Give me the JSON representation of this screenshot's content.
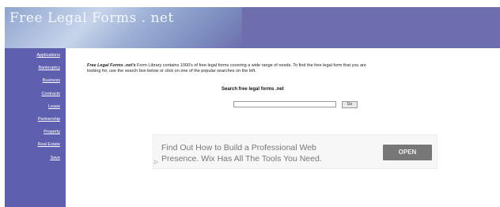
{
  "header": {
    "site_title": "Free Legal Forms . net"
  },
  "sidebar": {
    "items": [
      {
        "label": "Applications"
      },
      {
        "label": "Bankruptcy"
      },
      {
        "label": "Business"
      },
      {
        "label": "Contracts"
      },
      {
        "label": "Lease"
      },
      {
        "label": "Partnership"
      },
      {
        "label": "Property"
      },
      {
        "label": "Real Estate"
      },
      {
        "label": "Save"
      }
    ]
  },
  "main": {
    "intro_brand": "Free Legal Forms .net's",
    "intro_line1": " Form Library contains 1000's of free legal forms covering a wide range of needs. To find the free legal form that you are",
    "intro_line2": "looking for, use the search box below or click on one of the popular searches on the left.",
    "search_label": "Search free legal forms .net",
    "search_value": "",
    "go_label": "Go"
  },
  "ad": {
    "line1": "Find Out How to Build a Professional Web",
    "line2": "Presence. Wix Has All The Tools You Need.",
    "cta_label": "OPEN",
    "marker": "▷"
  }
}
